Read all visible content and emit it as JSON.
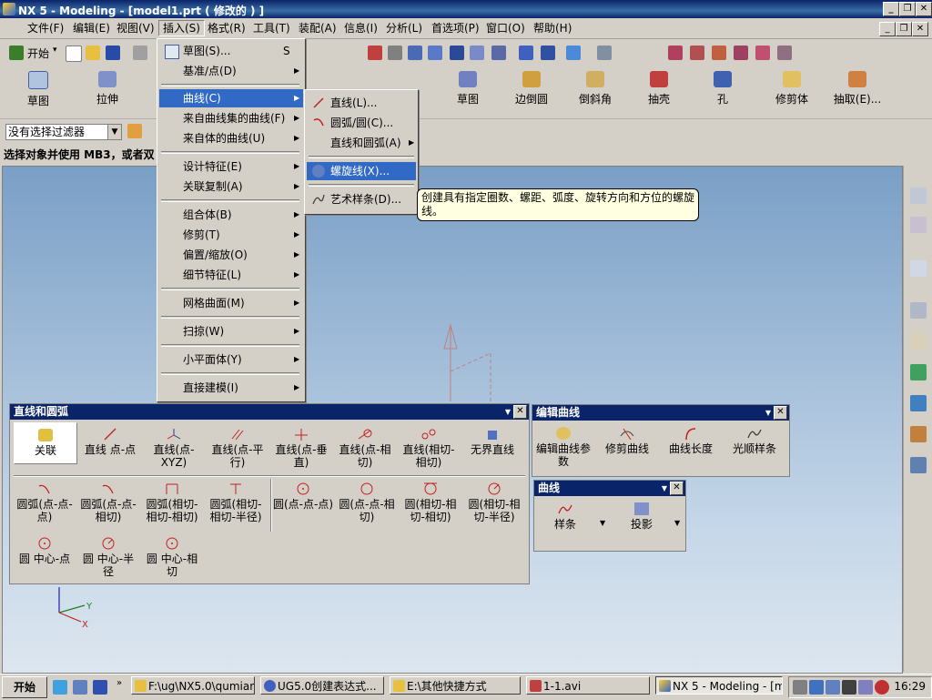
{
  "window": {
    "title": "NX 5 - Modeling - [model1.prt ( 修改的 ) ]"
  },
  "menubar": [
    "文件(F)",
    "编辑(E)",
    "视图(V)",
    "插入(S)",
    "格式(R)",
    "工具(T)",
    "装配(A)",
    "信息(I)",
    "分析(L)",
    "首选项(P)",
    "窗口(O)",
    "帮助(H)"
  ],
  "toolbar1": {
    "start_label": "开始",
    "start_arrow": "▾"
  },
  "toolbar2": {
    "left": [
      {
        "label": "草图",
        "icon": "sketch-icon"
      },
      {
        "label": "拉伸",
        "icon": "extrude-icon"
      }
    ],
    "right": [
      {
        "label": "草图",
        "icon": "sketch-icon"
      },
      {
        "label": "边倒圆",
        "icon": "edge-blend-icon"
      },
      {
        "label": "倒斜角",
        "icon": "chamfer-icon"
      },
      {
        "label": "抽壳",
        "icon": "shell-icon"
      },
      {
        "label": "孔",
        "icon": "hole-icon"
      },
      {
        "label": "修剪体",
        "icon": "trim-body-icon"
      },
      {
        "label": "抽取(E)...",
        "icon": "extract-icon"
      }
    ]
  },
  "filter": {
    "value": "没有选择过滤器"
  },
  "status": {
    "prompt": "选择对象并使用 MB3，或者双"
  },
  "insert_menu": {
    "items": [
      {
        "label": "草图(S)...",
        "shortcut": "S",
        "arrow": ""
      },
      {
        "label": "基准/点(D)",
        "shortcut": "",
        "arrow": "▶"
      },
      {
        "label": "曲线(C)",
        "shortcut": "",
        "arrow": "▶"
      },
      {
        "label": "来自曲线集的曲线(F)",
        "shortcut": "",
        "arrow": "▶"
      },
      {
        "label": "来自体的曲线(U)",
        "shortcut": "",
        "arrow": "▶"
      },
      {
        "label": "设计特征(E)",
        "shortcut": "",
        "arrow": "▶"
      },
      {
        "label": "关联复制(A)",
        "shortcut": "",
        "arrow": "▶"
      },
      {
        "label": "组合体(B)",
        "shortcut": "",
        "arrow": "▶"
      },
      {
        "label": "修剪(T)",
        "shortcut": "",
        "arrow": "▶"
      },
      {
        "label": "偏置/缩放(O)",
        "shortcut": "",
        "arrow": "▶"
      },
      {
        "label": "细节特征(L)",
        "shortcut": "",
        "arrow": "▶"
      },
      {
        "label": "网格曲面(M)",
        "shortcut": "",
        "arrow": "▶"
      },
      {
        "label": "扫掠(W)",
        "shortcut": "",
        "arrow": "▶"
      },
      {
        "label": "小平面体(Y)",
        "shortcut": "",
        "arrow": "▶"
      },
      {
        "label": "直接建模(I)",
        "shortcut": "",
        "arrow": "▶"
      }
    ]
  },
  "curve_submenu": {
    "items": [
      {
        "label": "直线(L)...",
        "icon": "line-icon",
        "arrow": ""
      },
      {
        "label": "圆弧/圆(C)...",
        "icon": "arc-icon",
        "arrow": ""
      },
      {
        "label": "直线和圆弧(A)",
        "icon": "",
        "arrow": "▶"
      },
      {
        "label": "螺旋线(X)...",
        "icon": "helix-icon",
        "arrow": ""
      },
      {
        "label": "艺术样条(D)...",
        "icon": "studio-spline-icon",
        "arrow": ""
      }
    ]
  },
  "tooltip": {
    "text": "创建具有指定圈数、螺距、弧度、旋转方向和方位的螺旋线。"
  },
  "lines_arcs_toolbar": {
    "title": "直线和圆弧",
    "row1": [
      "关联",
      "直线 点-点",
      "直线(点-XYZ)",
      "直线(点-平行)",
      "直线(点-垂直)",
      "直线(点-相切)",
      "直线(相切-相切)",
      "无界直线"
    ],
    "row2": [
      "圆弧(点-点-点)",
      "圆弧(点-点-相切)",
      "圆弧(相切-相切-相切)",
      "圆弧(相切-相切-半径)",
      "圆(点-点-点)",
      "圆(点-点-相切)",
      "圆(相切-相切-相切)",
      "圆(相切-相切-半径)"
    ],
    "row3": [
      "圆 中心-点",
      "圆 中心-半径",
      "圆 中心-相切"
    ]
  },
  "edit_curve_toolbar": {
    "title": "编辑曲线",
    "tools": [
      "编辑曲线参数",
      "修剪曲线",
      "曲线长度",
      "光顺样条"
    ]
  },
  "curve_toolbar": {
    "title": "曲线",
    "tools": [
      "样条",
      "投影"
    ]
  },
  "axes": {
    "y": "Y",
    "x": "X"
  },
  "taskbar": {
    "start": "开始",
    "tasks": [
      "F:\\ug\\NX5.0\\qumian...",
      "UG5.0创建表达式...",
      "E:\\其他快捷方式",
      "1-1.avi",
      "NX 5 - Modeling - [mo..."
    ],
    "clock": "16:29"
  }
}
